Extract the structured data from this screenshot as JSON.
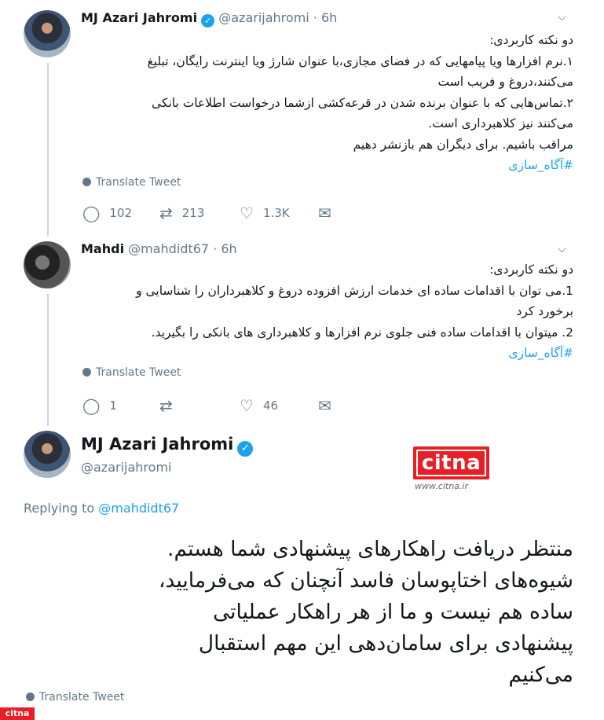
{
  "tweet1": {
    "name": "MJ Azari Jahromi",
    "handle": "@azarijahromi · 6h",
    "lines": [
      "دو نکته کاربردی:",
      "۱.نرم افزارها ویا پیامهایی که در فضای مجازی،با عنوان شارژ ویا اینترنت رایگان، تبلیغ",
      "می‌کنند،دروغ و فریب است",
      "۲.تماس‌هایی که با عنوان برنده شدن در قرعه‌کشی ازشما درخواست اطلاعات بانکی",
      "می‌کنند نیز کلاهبرداری است.",
      "مراقب باشیم. برای دیگران هم بازنشر دهیم"
    ],
    "hashtag": "#آگاه_سازی",
    "translate": "Translate Tweet",
    "replies": "102",
    "retweets": "213",
    "likes": "1.3K"
  },
  "tweet2": {
    "name": "Mahdi",
    "handle": "@mahdidt67 · 6h",
    "lines": [
      "دو نکته کاربردی:",
      "1.می توان با اقدامات ساده ای خدمات ارزش افزوده دروغ و کلاهبرداران را شناسایی و",
      "برخورد کرد",
      "2. میتوان با اقدامات ساده فنی جلوی نرم افزارها و کلاهبرداری های بانکی را بگیرید."
    ],
    "hashtag": "#آگاه_سازی",
    "translate": "Translate Tweet",
    "replies": "1",
    "retweets": "",
    "likes": "46"
  },
  "main": {
    "name": "MJ Azari Jahromi",
    "handle": "@azarijahromi",
    "replying_prefix": "Replying to",
    "replying_handle": "@mahdidt67",
    "lines": [
      "منتظر دریافت راهکارهای پیشنهادی شما هستم.",
      "شیوه‌های اختاپوسان فاسد آنچنان که می‌فرمایید،",
      "ساده هم نیست و ما از هر راهکار عملیاتی",
      "پیشنهادی برای سامان‌دهی این مهم استقبال",
      "می‌کنیم"
    ],
    "translate": "Translate Tweet"
  },
  "watermark": {
    "logo_text": "citna",
    "url": "www.citna.ir",
    "corner_text": "citna"
  }
}
